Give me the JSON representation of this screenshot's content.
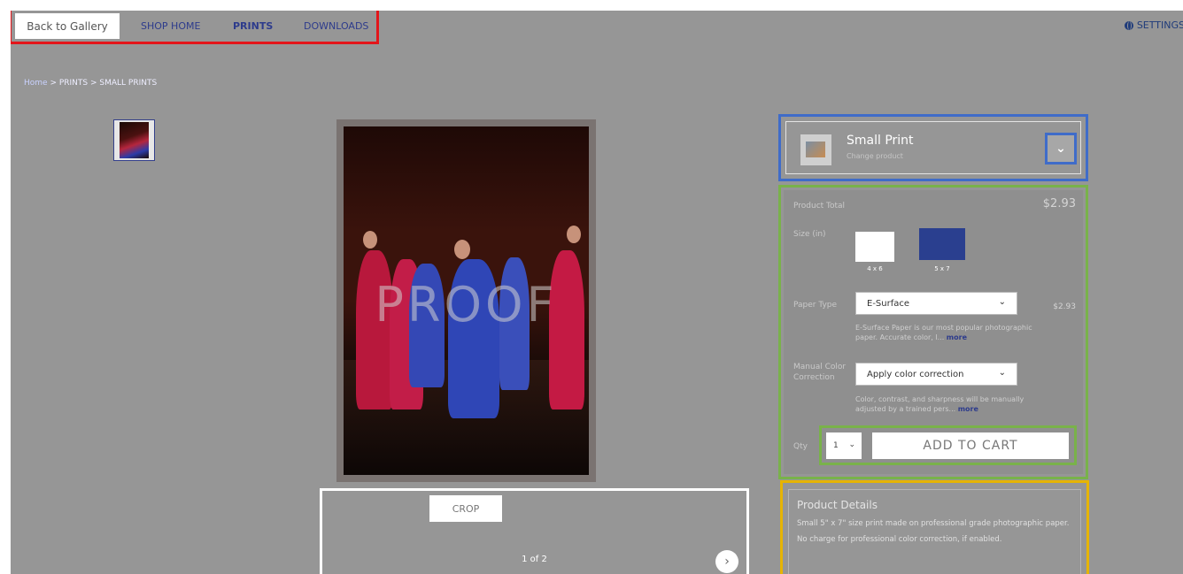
{
  "nav": {
    "back_label": "Back to Gallery",
    "shop_home": "SHOP HOME",
    "prints": "PRINTS",
    "downloads": "DOWNLOADS",
    "settings": "SETTINGS"
  },
  "breadcrumb": {
    "home": "Home",
    "sep1": " > ",
    "prints": "PRINTS",
    "sep2": " > ",
    "current": "SMALL PRINTS"
  },
  "photo": {
    "watermark": "PROOF"
  },
  "crop": {
    "label": "CROP",
    "pager": "1 of 2",
    "next_icon": "chevron-right-icon"
  },
  "product": {
    "name": "Small Print",
    "sub": "Change product"
  },
  "options": {
    "total_label": "Product Total",
    "total_value": "$2.93",
    "size_label": "Size (in)",
    "sizes": [
      {
        "label": "4 x 6",
        "color": "#ffffff"
      },
      {
        "label": "5 x 7",
        "color": "#2a3f8f"
      }
    ],
    "paper_label": "Paper Type",
    "paper_value": "E-Surface",
    "paper_price": "$2.93",
    "paper_desc": "E-Surface Paper is our most popular photographic paper. Accurate color, l...",
    "paper_more": "more",
    "color_label_1": "Manual Color",
    "color_label_2": "Correction",
    "color_value": "Apply color correction",
    "color_desc": "Color, contrast, and sharpness will be manually adjusted by a trained pers...",
    "color_more": "more",
    "qty_label": "Qty",
    "qty_value": "1",
    "add_to_cart": "ADD TO CART"
  },
  "details": {
    "title": "Product Details",
    "line1": "Small 5\" x 7\" size print made on professional grade photographic paper.",
    "line2": "No charge for professional color correction, if enabled."
  }
}
